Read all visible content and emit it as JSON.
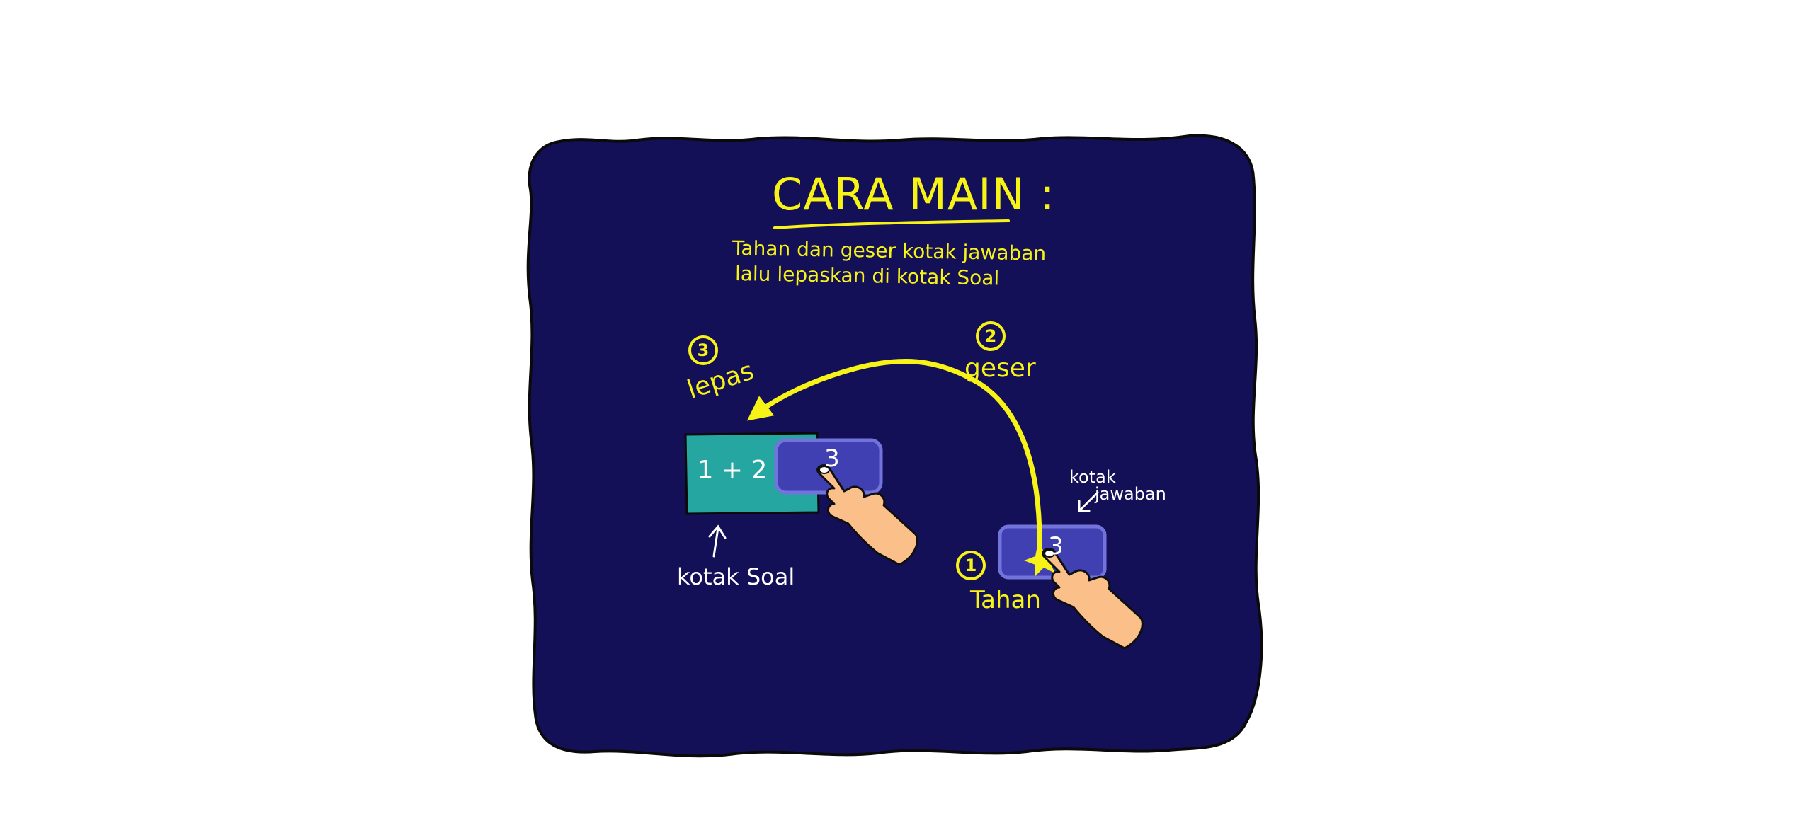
{
  "colors": {
    "background": "#ffffff",
    "panel": "#141057",
    "panel_outline": "#0a0a0a",
    "yellow": "#f7f317",
    "white": "#ffffff",
    "question_box": "#26a6a0",
    "answer_box": "#4040b2",
    "answer_box_border": "#7373dc",
    "hand_skin": "#fbbf8a",
    "outline": "#0f0f0f"
  },
  "instructions": {
    "title": "CARA MAIN :",
    "line1": "Tahan dan geser kotak jawaban",
    "line2": "lalu lepaskan di kotak Soal"
  },
  "steps": [
    {
      "number": "1",
      "label": "Tahan"
    },
    {
      "number": "2",
      "label": "geser"
    },
    {
      "number": "3",
      "label": "lepas"
    }
  ],
  "question_box": {
    "text": "1 + 2",
    "caption": "kotak Soal"
  },
  "answer_box": {
    "text": "3",
    "caption_line1": "kotak",
    "caption_line2": "jawaban"
  },
  "icons": {
    "arc_arrow": "curved-arrow-icon",
    "pointing_hand": "pointing-hand-icon",
    "tap_burst": "tap-burst-icon",
    "small_arrow": "arrow-icon"
  }
}
